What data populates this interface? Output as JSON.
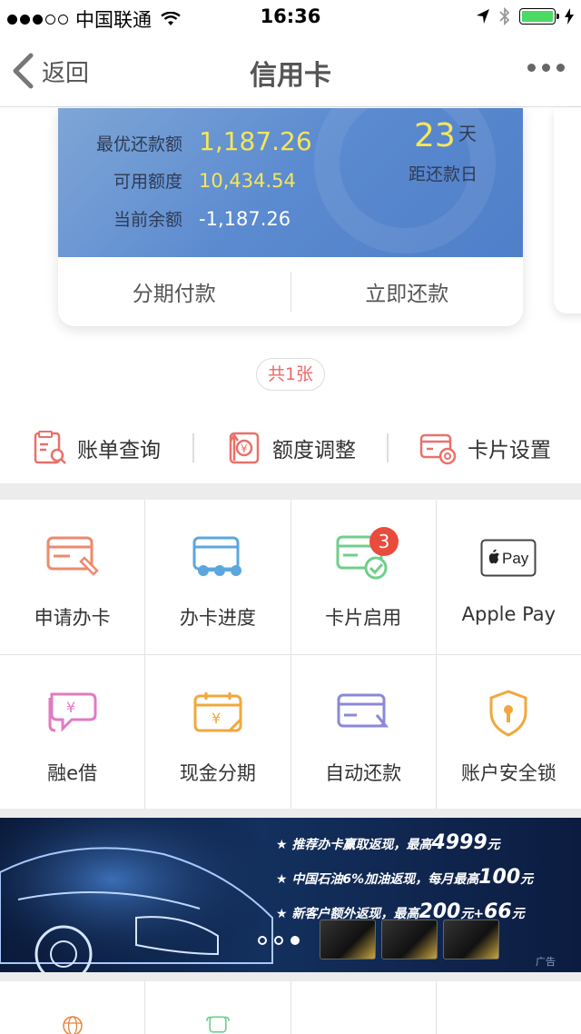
{
  "status_bar": {
    "carrier": "中国联通",
    "time": "16:36"
  },
  "nav": {
    "back_label": "返回",
    "title": "信用卡"
  },
  "card": {
    "min_payment_label": "最优还款额",
    "min_payment_value": "1,187.26",
    "available_label": "可用额度",
    "available_value": "10,434.54",
    "balance_label": "当前余额",
    "balance_value": "-1,187.26",
    "days_value": "23",
    "days_unit": "天",
    "due_label": "距还款日",
    "installment_label": "分期付款",
    "repay_label": "立即还款"
  },
  "card_count": "共1张",
  "quick_actions": [
    {
      "label": "账单查询",
      "icon": "bill-query-icon"
    },
    {
      "label": "额度调整",
      "icon": "limit-adjust-icon"
    },
    {
      "label": "卡片设置",
      "icon": "card-settings-icon"
    }
  ],
  "grid": [
    {
      "label": "申请办卡",
      "icon": "apply-card-icon"
    },
    {
      "label": "办卡进度",
      "icon": "card-progress-icon"
    },
    {
      "label": "卡片启用",
      "icon": "card-activate-icon",
      "badge": "3"
    },
    {
      "label": "Apple Pay",
      "icon": "apple-pay-icon"
    },
    {
      "label": "融e借",
      "icon": "loan-icon"
    },
    {
      "label": "现金分期",
      "icon": "cash-installment-icon"
    },
    {
      "label": "自动还款",
      "icon": "auto-repay-icon"
    },
    {
      "label": "账户安全锁",
      "icon": "security-lock-icon"
    }
  ],
  "banner": {
    "line1_prefix": "★ 推荐办卡赢取返现，最高",
    "line1_big": "4999",
    "line1_suffix": "元",
    "line2_prefix": "★ 中国石油6%加油返现，每月最高",
    "line2_big": "100",
    "line2_suffix": "元",
    "line3_prefix": "★ 新客户额外返现，最高",
    "line3_big": "200",
    "line3_mid": "元+",
    "line3_big2": "66",
    "line3_suffix": "元",
    "ad_label": "广告"
  },
  "colors": {
    "accent_yellow": "#f5e65a",
    "badge_red": "#e94b3c",
    "card_blue": "#5b8ad0"
  }
}
